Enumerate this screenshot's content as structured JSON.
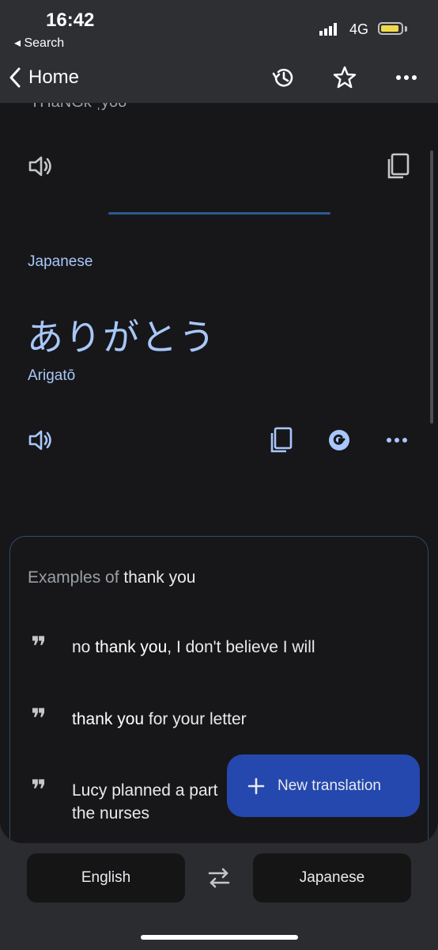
{
  "status_bar": {
    "time": "16:42",
    "back_label": "◂ Search",
    "network": "4G"
  },
  "app_bar": {
    "back_label": "Home",
    "icons": [
      "history-icon",
      "star-icon",
      "more-vert-icon"
    ]
  },
  "source_panel": {
    "truncated_text": "THaNGk ˌyoo"
  },
  "target_panel": {
    "language_label": "Japanese",
    "translation": "ありがとう",
    "romanization": "Arigatō"
  },
  "examples": {
    "title_prefix": "Examples of",
    "title_term": "thank you",
    "items": [
      {
        "before": "no ",
        "bold": "thank you",
        "after": ", I don't believe I will"
      },
      {
        "before": "",
        "bold": "thank you",
        "after": " for your letter"
      },
      {
        "before": "Lucy planned a part",
        "bold": "",
        "after": "",
        "line2": "the nurses"
      }
    ]
  },
  "fab": {
    "label": "New translation"
  },
  "bottom_bar": {
    "source_language": "English",
    "target_language": "Japanese"
  },
  "colors": {
    "accent": "#a8c7fa",
    "fab": "#2448ae",
    "sheet": "#171719",
    "chrome": "#2e2f33"
  }
}
